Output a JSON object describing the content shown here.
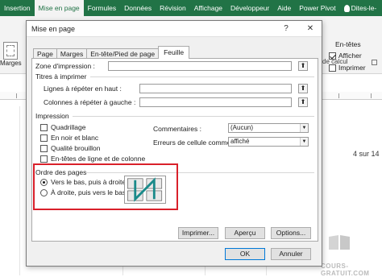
{
  "ribbon": {
    "tabs": [
      {
        "label": "Insertion"
      },
      {
        "label": "Mise en page",
        "active": true
      },
      {
        "label": "Formules"
      },
      {
        "label": "Données"
      },
      {
        "label": "Révision"
      },
      {
        "label": "Affichage"
      },
      {
        "label": "Développeur"
      },
      {
        "label": "Aide"
      },
      {
        "label": "Power Pivot"
      }
    ],
    "tell_me": "Dites-le-",
    "margins_label": "Marges",
    "headings_group": {
      "title": "En-têtes",
      "show_label": "Afficher",
      "show_checked": true,
      "print_label": "Imprimer",
      "print_checked": false
    },
    "group_label": "de calcul",
    "accent_color": "#217346"
  },
  "sheet": {
    "page_count": "4 sur 14",
    "watermark": "COURS-GRATUIT.COM"
  },
  "dialog": {
    "title": "Mise en page",
    "help_glyph": "?",
    "close_glyph": "✕",
    "tabs": [
      {
        "label": "Page"
      },
      {
        "label": "Marges"
      },
      {
        "label": "En-tête/Pied de page"
      },
      {
        "label": "Feuille",
        "active": true
      }
    ],
    "print_area_label": "Zone d'impression :",
    "print_area_value": "",
    "print_titles_header": "Titres à imprimer",
    "rows_repeat_label": "Lignes à répéter en haut :",
    "rows_repeat_value": "",
    "cols_repeat_label": "Colonnes à répéter à gauche :",
    "cols_repeat_value": "",
    "print_section_header": "Impression",
    "gridlines_label": "Quadrillage",
    "bw_label": "En noir et blanc",
    "draft_label": "Qualité brouillon",
    "headings_label": "En-têtes de ligne et de colonne",
    "comments_label": "Commentaires :",
    "comments_value": "(Aucun)",
    "errors_label": "Erreurs de cellule comme :",
    "errors_value": "affiché",
    "page_order_header": "Ordre des pages",
    "down_then_over_label": "Vers le bas, puis à droite",
    "down_then_over_checked": true,
    "over_then_down_label": "À droite, puis vers le bas",
    "over_then_down_checked": false,
    "highlight_color": "#d9202a",
    "print_button": "Imprimer...",
    "preview_button": "Aperçu",
    "options_button": "Options...",
    "ok_button": "OK",
    "cancel_button": "Annuler"
  }
}
